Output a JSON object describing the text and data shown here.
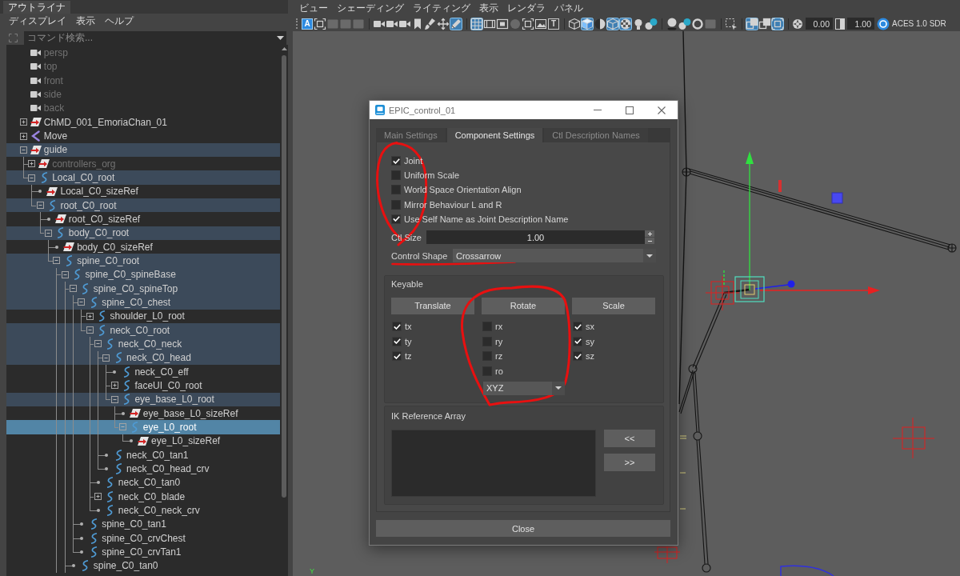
{
  "outliner": {
    "tab": "アウトライナ",
    "menu": [
      "ディスプレイ",
      "表示",
      "ヘルプ"
    ],
    "search": {
      "placeholder": "コマンド検索..."
    },
    "tree": [
      {
        "name": "persp",
        "kind": "camera",
        "dimmed": true,
        "highlighted": false,
        "selected": false
      },
      {
        "name": "top",
        "kind": "camera",
        "dimmed": true,
        "highlighted": false,
        "selected": false
      },
      {
        "name": "front",
        "kind": "camera",
        "dimmed": true,
        "highlighted": false,
        "selected": false
      },
      {
        "name": "side",
        "kind": "camera",
        "dimmed": true,
        "highlighted": false,
        "selected": false
      },
      {
        "name": "back",
        "kind": "camera",
        "dimmed": true,
        "highlighted": false,
        "selected": false
      },
      {
        "name": "ChMD_001_EmoriaChan_01",
        "kind": "transform",
        "expanded": false,
        "dimmed": false,
        "highlighted": false,
        "selected": false
      },
      {
        "name": "Move",
        "kind": "joint",
        "expanded": false,
        "dimmed": false,
        "highlighted": false,
        "selected": false
      },
      {
        "name": "guide",
        "kind": "transform",
        "expanded": true,
        "dimmed": false,
        "highlighted": true,
        "selected": false,
        "children": [
          {
            "name": "controllers_org",
            "kind": "transform",
            "expanded": false,
            "dimmed": true,
            "highlighted": false,
            "selected": false
          },
          {
            "name": "Local_C0_root",
            "kind": "curve",
            "expanded": true,
            "dimmed": false,
            "highlighted": true,
            "selected": false,
            "children": [
              {
                "name": "Local_C0_sizeRef",
                "kind": "transform",
                "dimmed": false,
                "highlighted": false,
                "selected": false
              },
              {
                "name": "root_C0_root",
                "kind": "curve",
                "expanded": true,
                "dimmed": false,
                "highlighted": true,
                "selected": false,
                "children": [
                  {
                    "name": "root_C0_sizeRef",
                    "kind": "transform",
                    "dimmed": false,
                    "highlighted": false,
                    "selected": false
                  },
                  {
                    "name": "body_C0_root",
                    "kind": "curve",
                    "expanded": true,
                    "dimmed": false,
                    "highlighted": true,
                    "selected": false,
                    "children": [
                      {
                        "name": "body_C0_sizeRef",
                        "kind": "transform",
                        "dimmed": false,
                        "highlighted": false,
                        "selected": false
                      },
                      {
                        "name": "spine_C0_root",
                        "kind": "curve",
                        "expanded": true,
                        "dimmed": false,
                        "highlighted": true,
                        "selected": false,
                        "more_below": true,
                        "children": [
                          {
                            "name": "spine_C0_spineBase",
                            "kind": "curve",
                            "expanded": true,
                            "dimmed": false,
                            "highlighted": true,
                            "selected": false,
                            "more_below": true,
                            "children": [
                              {
                                "name": "spine_C0_spineTop",
                                "kind": "curve",
                                "expanded": true,
                                "dimmed": false,
                                "highlighted": true,
                                "selected": false,
                                "children": [
                                  {
                                    "name": "spine_C0_chest",
                                    "kind": "curve",
                                    "expanded": true,
                                    "dimmed": false,
                                    "highlighted": true,
                                    "selected": false,
                                    "children": [
                                      {
                                        "name": "shoulder_L0_root",
                                        "kind": "curve",
                                        "expanded": false,
                                        "dimmed": false,
                                        "highlighted": false,
                                        "selected": false
                                      },
                                      {
                                        "name": "neck_C0_root",
                                        "kind": "curve",
                                        "expanded": true,
                                        "dimmed": false,
                                        "highlighted": true,
                                        "selected": false,
                                        "children": [
                                          {
                                            "name": "neck_C0_neck",
                                            "kind": "curve",
                                            "expanded": true,
                                            "dimmed": false,
                                            "highlighted": true,
                                            "selected": false,
                                            "children": [
                                              {
                                                "name": "neck_C0_head",
                                                "kind": "curve",
                                                "expanded": true,
                                                "dimmed": false,
                                                "highlighted": true,
                                                "selected": false,
                                                "children": [
                                                  {
                                                    "name": "neck_C0_eff",
                                                    "kind": "curve",
                                                    "dimmed": false,
                                                    "highlighted": false,
                                                    "selected": false
                                                  },
                                                  {
                                                    "name": "faceUI_C0_root",
                                                    "kind": "curve",
                                                    "expanded": false,
                                                    "dimmed": false,
                                                    "highlighted": false,
                                                    "selected": false
                                                  },
                                                  {
                                                    "name": "eye_base_L0_root",
                                                    "kind": "curve",
                                                    "expanded": true,
                                                    "dimmed": false,
                                                    "highlighted": true,
                                                    "selected": false,
                                                    "children": [
                                                      {
                                                        "name": "eye_base_L0_sizeRef",
                                                        "kind": "transform",
                                                        "dimmed": false,
                                                        "highlighted": false,
                                                        "selected": false
                                                      },
                                                      {
                                                        "name": "eye_L0_root",
                                                        "kind": "curve",
                                                        "expanded": true,
                                                        "dimmed": false,
                                                        "highlighted": false,
                                                        "selected": true,
                                                        "children": [
                                                          {
                                                            "name": "eye_L0_sizeRef",
                                                            "kind": "transform",
                                                            "dimmed": false,
                                                            "highlighted": false,
                                                            "selected": false
                                                          }
                                                        ]
                                                      }
                                                    ]
                                                  }
                                                ]
                                              },
                                              {
                                                "name": "neck_C0_tan1",
                                                "kind": "curve",
                                                "dimmed": false,
                                                "highlighted": false,
                                                "selected": false
                                              },
                                              {
                                                "name": "neck_C0_head_crv",
                                                "kind": "curve",
                                                "dimmed": false,
                                                "highlighted": false,
                                                "selected": false
                                              }
                                            ]
                                          },
                                          {
                                            "name": "neck_C0_tan0",
                                            "kind": "curve",
                                            "dimmed": false,
                                            "highlighted": false,
                                            "selected": false
                                          },
                                          {
                                            "name": "neck_C0_blade",
                                            "kind": "curve",
                                            "expanded": false,
                                            "dimmed": false,
                                            "highlighted": false,
                                            "selected": false
                                          },
                                          {
                                            "name": "neck_C0_neck_crv",
                                            "kind": "curve",
                                            "dimmed": false,
                                            "highlighted": false,
                                            "selected": false
                                          }
                                        ]
                                      }
                                    ]
                                  },
                                  {
                                    "name": "spine_C0_tan1",
                                    "kind": "curve",
                                    "dimmed": false,
                                    "highlighted": false,
                                    "selected": false
                                  },
                                  {
                                    "name": "spine_C0_crvChest",
                                    "kind": "curve",
                                    "dimmed": false,
                                    "highlighted": false,
                                    "selected": false
                                  },
                                  {
                                    "name": "spine_C0_crvTan1",
                                    "kind": "curve",
                                    "dimmed": false,
                                    "highlighted": false,
                                    "selected": false
                                  }
                                ]
                              },
                              {
                                "name": "spine_C0_tan0",
                                "kind": "curve",
                                "dimmed": false,
                                "highlighted": false,
                                "selected": false
                              }
                            ]
                          }
                        ]
                      }
                    ]
                  }
                ]
              }
            ]
          }
        ]
      }
    ]
  },
  "viewport": {
    "menu": [
      "ビュー",
      "シェーディング",
      "ライティング",
      "表示",
      "レンダラ",
      "パネル"
    ],
    "toolbar": {
      "groups": [
        {
          "items": [
            {
              "kind": "letter",
              "glyph": "A",
              "on": true,
              "disabled": false
            },
            {
              "kind": "frame",
              "on": false,
              "disabled": false
            },
            {
              "kind": "card",
              "on": false,
              "disabled": true
            },
            {
              "kind": "card",
              "on": false,
              "disabled": true
            },
            {
              "kind": "card",
              "on": false,
              "disabled": true
            }
          ]
        },
        {
          "items": [
            {
              "kind": "camera",
              "on": false,
              "disabled": false
            },
            {
              "kind": "camera",
              "on": false,
              "disabled": false
            },
            {
              "kind": "camera",
              "on": false,
              "disabled": false
            },
            {
              "kind": "bookmark",
              "on": false,
              "disabled": false
            },
            {
              "kind": "brush",
              "on": false,
              "disabled": false
            },
            {
              "kind": "move-cross",
              "on": false,
              "disabled": false
            },
            {
              "kind": "pencil",
              "on": true,
              "disabled": false
            }
          ]
        },
        {
          "items": [
            {
              "kind": "grid",
              "on": true,
              "disabled": false
            },
            {
              "kind": "film",
              "on": false,
              "disabled": false
            },
            {
              "kind": "square",
              "on": false,
              "disabled": false
            },
            {
              "kind": "circle",
              "on": false,
              "disabled": true
            },
            {
              "kind": "frame",
              "on": false,
              "disabled": false
            },
            {
              "kind": "picture",
              "on": false,
              "disabled": false
            },
            {
              "kind": "letter",
              "glyph": "T",
              "on": false,
              "disabled": false
            }
          ]
        },
        {
          "items": [
            {
              "kind": "cube",
              "on": false,
              "disabled": false
            },
            {
              "kind": "shaded-cube",
              "on": true,
              "disabled": false
            },
            {
              "kind": "half-sphere",
              "on": false,
              "disabled": false
            },
            {
              "kind": "cube",
              "on": true,
              "disabled": false
            },
            {
              "kind": "checker",
              "on": true,
              "disabled": false
            },
            {
              "kind": "bulb",
              "on": false,
              "disabled": false
            },
            {
              "kind": "spheres",
              "on": false,
              "disabled": false
            }
          ]
        },
        {
          "items": [
            {
              "kind": "sphere",
              "on": false,
              "disabled": false
            },
            {
              "kind": "spheres",
              "on": false,
              "disabled": false
            },
            {
              "kind": "ring",
              "on": false,
              "disabled": false
            },
            {
              "kind": "card",
              "on": false,
              "disabled": true
            }
          ]
        },
        {
          "items": [
            {
              "kind": "dashed-select",
              "on": false,
              "disabled": false
            }
          ]
        },
        {
          "items": [
            {
              "kind": "stacked-squares",
              "on": true,
              "disabled": false
            },
            {
              "kind": "stacked-squares",
              "on": false,
              "disabled": false
            },
            {
              "kind": "frame",
              "on": true,
              "disabled": false
            }
          ]
        }
      ],
      "exposure": {
        "value": "0.00"
      },
      "gamma": {
        "value": "1.00"
      },
      "color_management": {
        "on": true,
        "label": "ACES 1.0 SDR"
      }
    },
    "axis_label": "Y"
  },
  "dialog": {
    "title": "EPIC_control_01",
    "tabs": [
      {
        "label": "Main Settings",
        "selected": false
      },
      {
        "label": "Component Settings",
        "selected": true
      },
      {
        "label": "Ctl Description Names",
        "selected": false
      }
    ],
    "options": [
      {
        "label": "Joint",
        "checked": true
      },
      {
        "label": "Uniform Scale",
        "checked": false
      },
      {
        "label": "World Space Orientation Align",
        "checked": false
      },
      {
        "label": "Mirror Behaviour L and R",
        "checked": false
      },
      {
        "label": "Use Self Name as Joint Description Name",
        "checked": true
      }
    ],
    "ctl_size": {
      "label": "Ctl Size",
      "value": "1.00"
    },
    "control_shape": {
      "label": "Control Shape",
      "value": "Crossarrow"
    },
    "keyable": {
      "title": "Keyable",
      "columns": [
        {
          "button": "Translate",
          "channels": [
            {
              "label": "tx",
              "checked": true
            },
            {
              "label": "ty",
              "checked": true
            },
            {
              "label": "tz",
              "checked": true
            }
          ]
        },
        {
          "button": "Rotate",
          "channels": [
            {
              "label": "rx",
              "checked": false
            },
            {
              "label": "ry",
              "checked": false
            },
            {
              "label": "rz",
              "checked": false
            },
            {
              "label": "ro",
              "checked": false
            }
          ],
          "order": "XYZ"
        },
        {
          "button": "Scale",
          "channels": [
            {
              "label": "sx",
              "checked": true
            },
            {
              "label": "sy",
              "checked": true
            },
            {
              "label": "sz",
              "checked": true
            }
          ]
        }
      ]
    },
    "ik_reference": {
      "title": "IK Reference Array",
      "buttons": [
        "<<",
        ">>"
      ]
    },
    "close": "Close"
  }
}
